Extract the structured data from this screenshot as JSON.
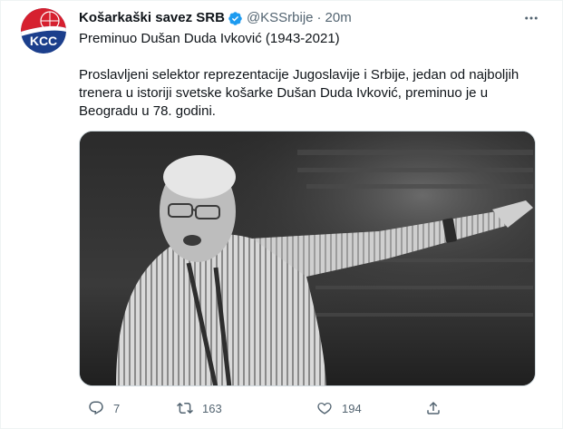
{
  "account": {
    "display_name": "Košarkaški savez SRB",
    "handle": "@KSSrbije",
    "separator": "·",
    "time": "20m",
    "avatar_text": "KCC",
    "verified_icon": "verified-badge-icon"
  },
  "tweet": {
    "headline": "Preminuo Dušan Duda Ivković (1943-2021)",
    "body_lines": [
      "Proslavljeni selektor reprezentacije Jugoslavije i Srbije, jedan od najboljih",
      "trenera u istoriji svetske košarke Dušan Duda Ivković, preminuo je u",
      "Beogradu u 78. godini."
    ],
    "media_icon": "photo"
  },
  "actions": {
    "reply_count": "7",
    "retweet_count": "163",
    "like_count": "194"
  },
  "colors": {
    "text": "#0f1419",
    "secondary": "#536471",
    "verified": "#1d9bf0",
    "border": "#cfd9de"
  }
}
